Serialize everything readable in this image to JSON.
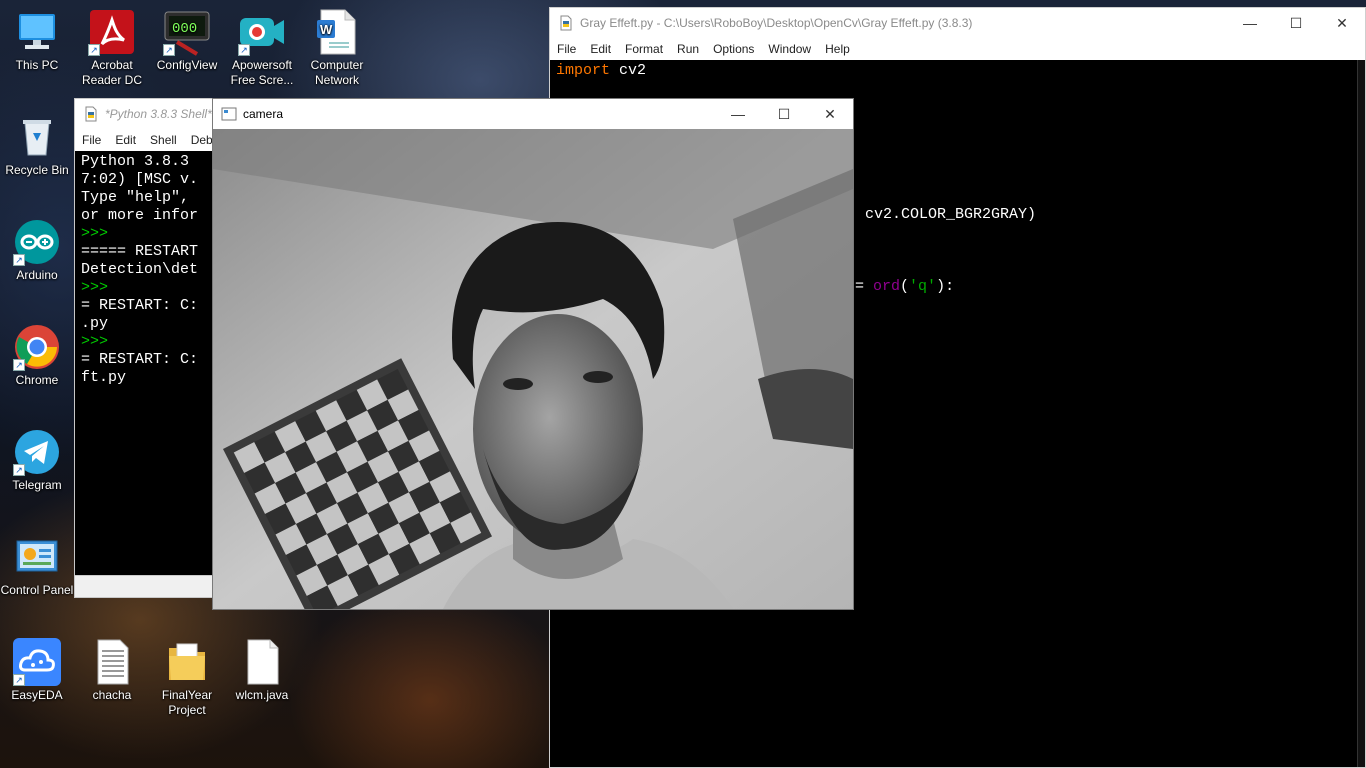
{
  "desktop": {
    "icons": [
      {
        "label": "This PC",
        "icon": "monitor-icon"
      },
      {
        "label": "Acrobat Reader DC",
        "icon": "acrobat-icon"
      },
      {
        "label": "ConfigView",
        "icon": "configview-icon"
      },
      {
        "label": "Apowersoft Free Scre...",
        "icon": "apowersoft-icon"
      },
      {
        "label": "Computer Network",
        "icon": "document-icon"
      },
      {
        "label": "Recycle Bin",
        "icon": "recycle-bin-icon"
      },
      {
        "label": "Arduino",
        "icon": "arduino-icon"
      },
      {
        "label": "Chrome",
        "icon": "chrome-icon"
      },
      {
        "label": "Telegram",
        "icon": "telegram-icon"
      },
      {
        "label": "Control Panel",
        "icon": "control-panel-icon"
      },
      {
        "label": "EasyEDA",
        "icon": "easyeda-icon"
      },
      {
        "label": "chacha",
        "icon": "text-file-icon"
      },
      {
        "label": "FinalYear Project",
        "icon": "folder-icon"
      },
      {
        "label": "wlcm.java",
        "icon": "blank-file-icon"
      }
    ]
  },
  "editor": {
    "title": "Gray Effeft.py - C:\\Users\\RoboBoy\\Desktop\\OpenCv\\Gray Effeft.py (3.8.3)",
    "menu": [
      "File",
      "Edit",
      "Format",
      "Run",
      "Options",
      "Window",
      "Help"
    ],
    "code": {
      "line1_kw": "import",
      "line1_rest": " cv2",
      "line2": "cv2.COLOR_BGR2GRAY)",
      "line3_eq": "= ",
      "line3_fn": "ord",
      "line3_open": "(",
      "line3_str": "'q'",
      "line3_close": "):"
    }
  },
  "shell": {
    "title": "*Python 3.8.3 Shell*",
    "menu": [
      "File",
      "Edit",
      "Shell",
      "Debu"
    ],
    "lines": [
      {
        "text": "Python 3.8.3",
        "prompt": false
      },
      {
        "text": "7:02) [MSC v.",
        "prompt": false
      },
      {
        "text": "Type \"help\",",
        "prompt": false
      },
      {
        "text": "or more infor",
        "prompt": false
      },
      {
        "text": ">>>",
        "prompt": true
      },
      {
        "text": "===== RESTART",
        "prompt": false
      },
      {
        "text": "Detection\\det",
        "prompt": false
      },
      {
        "text": ">>>",
        "prompt": true
      },
      {
        "text": "= RESTART: C:",
        "prompt": false
      },
      {
        "text": ".py",
        "prompt": false
      },
      {
        "text": ">>>",
        "prompt": true
      },
      {
        "text": "= RESTART: C:",
        "prompt": false
      },
      {
        "text": "ft.py",
        "prompt": false
      }
    ]
  },
  "camera": {
    "title": "camera"
  },
  "window_controls": {
    "minimize": "—",
    "maximize": "☐",
    "close": "✕"
  }
}
